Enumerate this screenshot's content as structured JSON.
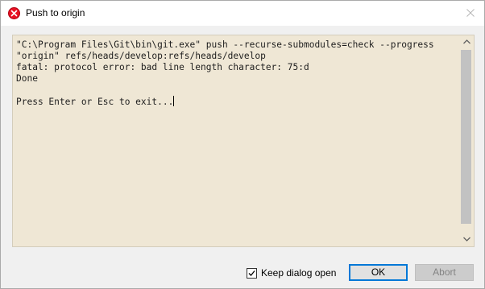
{
  "window": {
    "title": "Push to origin",
    "title_icon": "error-icon",
    "close_icon": "close-icon"
  },
  "console": {
    "lines": [
      "\"C:\\Program Files\\Git\\bin\\git.exe\" push --recurse-submodules=check --progress",
      "\"origin\" refs/heads/develop:refs/heads/develop",
      "fatal: protocol error: bad line length character: 75:d",
      "Done",
      "",
      "Press Enter or Esc to exit..."
    ]
  },
  "footer": {
    "keep_dialog_open_label": "Keep dialog open",
    "keep_dialog_open_checked": true,
    "ok_label": "OK",
    "abort_label": "Abort",
    "abort_enabled": false
  },
  "colors": {
    "console_bg": "#efe7d5",
    "accent": "#0078d7",
    "error_icon": "#e81123"
  }
}
